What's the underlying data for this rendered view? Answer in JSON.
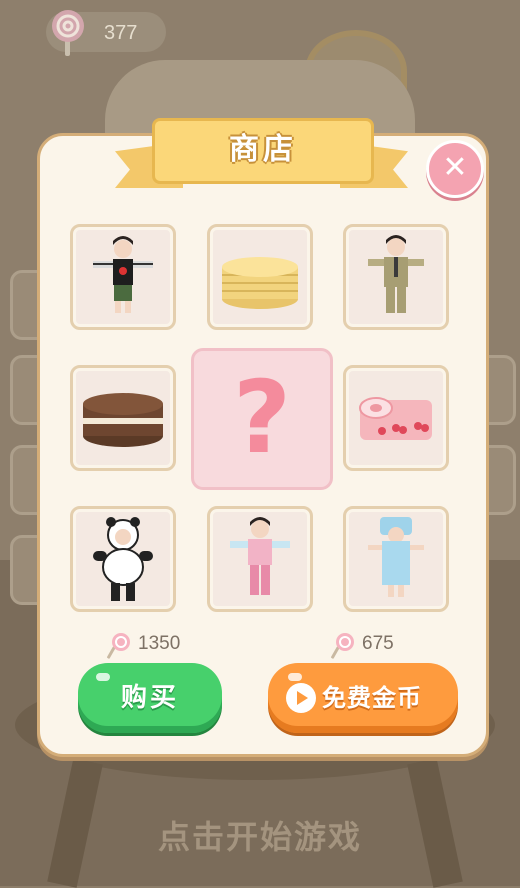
{
  "hud": {
    "candy_count": "377"
  },
  "shop": {
    "title": "商店",
    "items": [
      {
        "name": "outfit-striped-shirt"
      },
      {
        "name": "pancake-stack"
      },
      {
        "name": "outfit-khaki-suit"
      },
      {
        "name": "chocolate-cake"
      },
      {
        "name": "mystery-item",
        "label": "?"
      },
      {
        "name": "cherry-roll-cake"
      },
      {
        "name": "panda-costume"
      },
      {
        "name": "pink-pajamas"
      },
      {
        "name": "blue-towel-outfit"
      }
    ],
    "buy_price": "1350",
    "free_price": "675",
    "buy_label": "购买",
    "free_label": "免费金币"
  },
  "footer": {
    "start_text": "点击开始游戏"
  },
  "colors": {
    "panel": "#fbf5ea",
    "buy": "#47d06c",
    "free": "#fe9b3e",
    "ribbon": "#fbd779",
    "close": "#f4a3b1"
  }
}
